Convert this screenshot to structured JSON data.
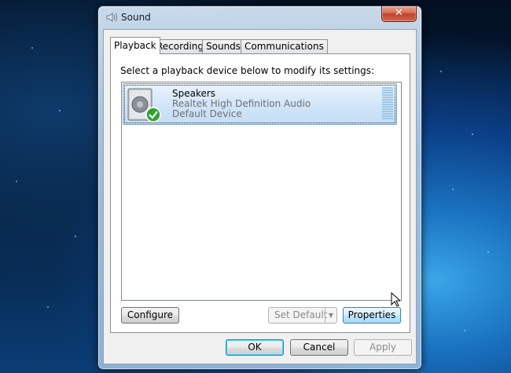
{
  "window": {
    "title": "Sound",
    "close_label": "✕"
  },
  "tabs": [
    {
      "label": "Playback",
      "active": true
    },
    {
      "label": "Recording",
      "active": false
    },
    {
      "label": "Sounds",
      "active": false
    },
    {
      "label": "Communications",
      "active": false
    }
  ],
  "playback": {
    "instructions": "Select a playback device below to modify its settings:",
    "devices": [
      {
        "name": "Speakers",
        "description": "Realtek High Definition Audio",
        "status": "Default Device",
        "selected": true,
        "icon": "speaker-icon",
        "status_icon": "green-check-icon"
      }
    ],
    "buttons": {
      "configure": "Configure",
      "set_default": "Set Default",
      "set_default_arrow": "▼",
      "properties": "Properties"
    }
  },
  "dialog_buttons": {
    "ok": "OK",
    "cancel": "Cancel",
    "apply": "Apply"
  },
  "colors": {
    "selection": "#cce4f7",
    "close_button": "#c74a32",
    "check_green": "#2fa52f"
  }
}
